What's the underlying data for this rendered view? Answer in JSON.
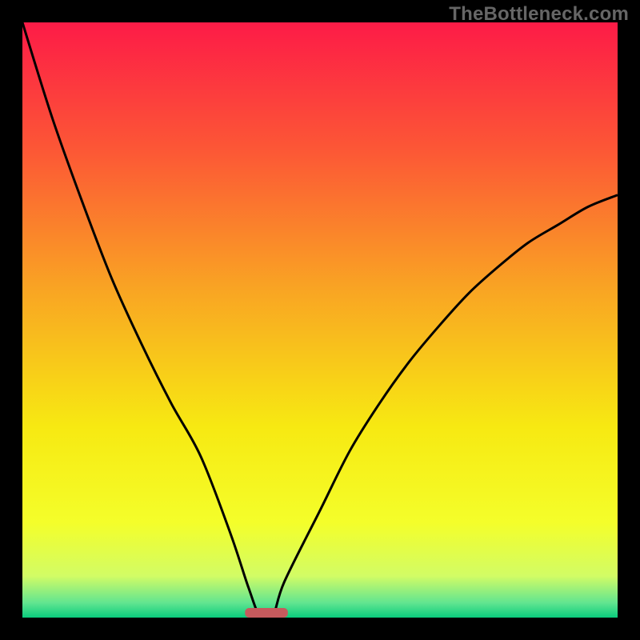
{
  "watermark": "TheBottleneck.com",
  "chart_data": {
    "type": "line",
    "title": "",
    "xlabel": "",
    "ylabel": "",
    "xlim": [
      0,
      100
    ],
    "ylim": [
      0,
      100
    ],
    "grid": false,
    "legend": false,
    "series": [
      {
        "name": "curve",
        "x": [
          0,
          5,
          10,
          15,
          20,
          25,
          30,
          35,
          38,
          40,
          42,
          44,
          50,
          55,
          60,
          65,
          70,
          75,
          80,
          85,
          90,
          95,
          100
        ],
        "y": [
          100,
          84,
          70,
          57,
          46,
          36,
          27,
          14,
          5,
          0,
          0,
          6,
          18,
          28,
          36,
          43,
          49,
          54.5,
          59,
          63,
          66,
          69,
          71
        ]
      }
    ],
    "marker": {
      "name": "optimum-marker",
      "x_center": 41,
      "x_halfwidth": 3.6,
      "color": "#c65a5d"
    },
    "gradient_stops": [
      {
        "offset": 0.0,
        "color": "#fd1b47"
      },
      {
        "offset": 0.22,
        "color": "#fc5935"
      },
      {
        "offset": 0.45,
        "color": "#f9a523"
      },
      {
        "offset": 0.68,
        "color": "#f7e912"
      },
      {
        "offset": 0.84,
        "color": "#f4fe2a"
      },
      {
        "offset": 0.93,
        "color": "#d2fc65"
      },
      {
        "offset": 0.975,
        "color": "#62e590"
      },
      {
        "offset": 1.0,
        "color": "#0acc7d"
      }
    ]
  }
}
